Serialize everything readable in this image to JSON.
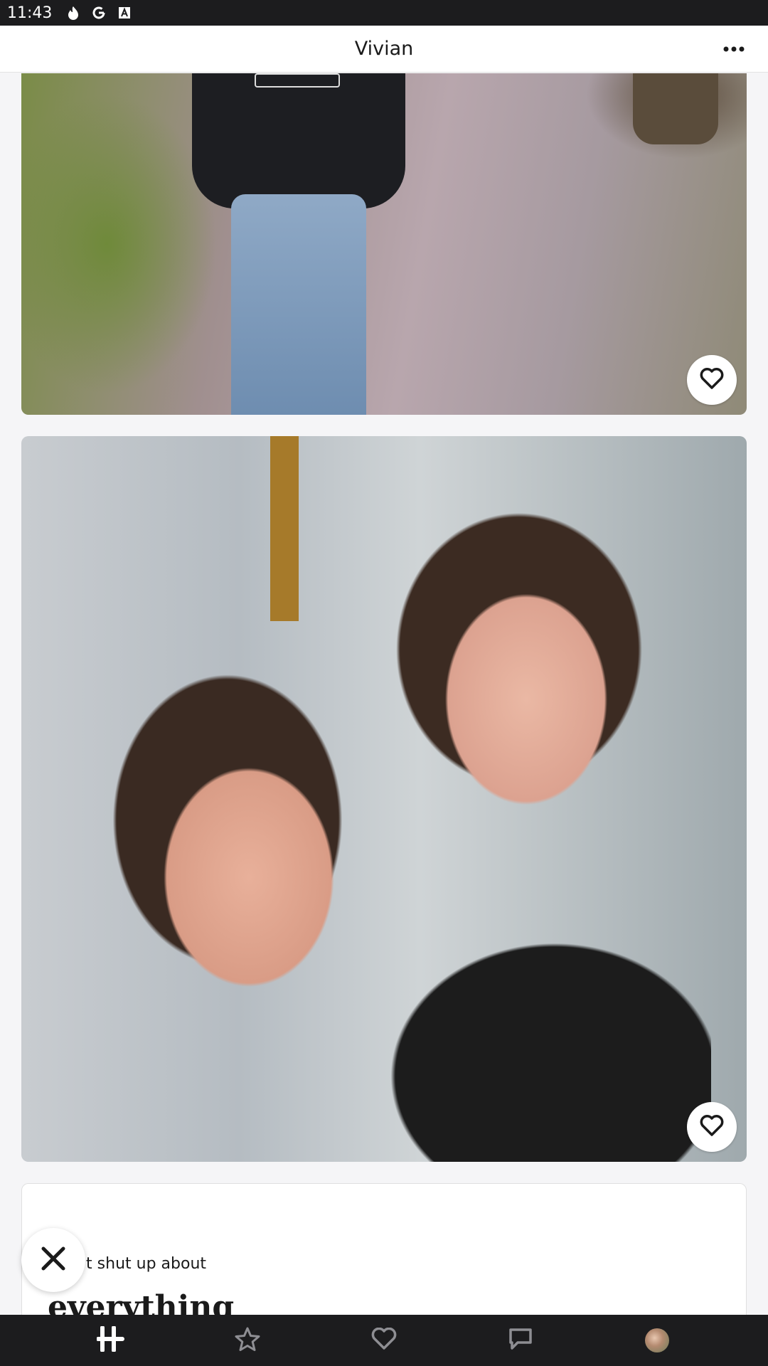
{
  "status_bar": {
    "time": "11:43",
    "icons": [
      "flame-icon",
      "google-icon",
      "a-icon"
    ]
  },
  "header": {
    "title": "Vivian",
    "more_icon": "more-horizontal-icon"
  },
  "feed": {
    "photo_cards": [
      {
        "like_icon": "heart-icon"
      },
      {
        "like_icon": "heart-icon"
      }
    ],
    "prompt": {
      "question": "'t shut up about",
      "answer": "everything"
    }
  },
  "skip_icon": "close-icon",
  "bottom_nav": {
    "items": [
      {
        "name": "home",
        "icon": "hinge-logo-icon",
        "active": true
      },
      {
        "name": "standouts",
        "icon": "star-icon"
      },
      {
        "name": "likes",
        "icon": "heart-icon"
      },
      {
        "name": "matches",
        "icon": "chat-icon"
      },
      {
        "name": "profile",
        "icon": "avatar"
      }
    ]
  },
  "colors": {
    "status_bar_bg": "#1c1c1e",
    "nav_bg": "#1c1c1e",
    "page_bg": "#f5f5f7"
  }
}
